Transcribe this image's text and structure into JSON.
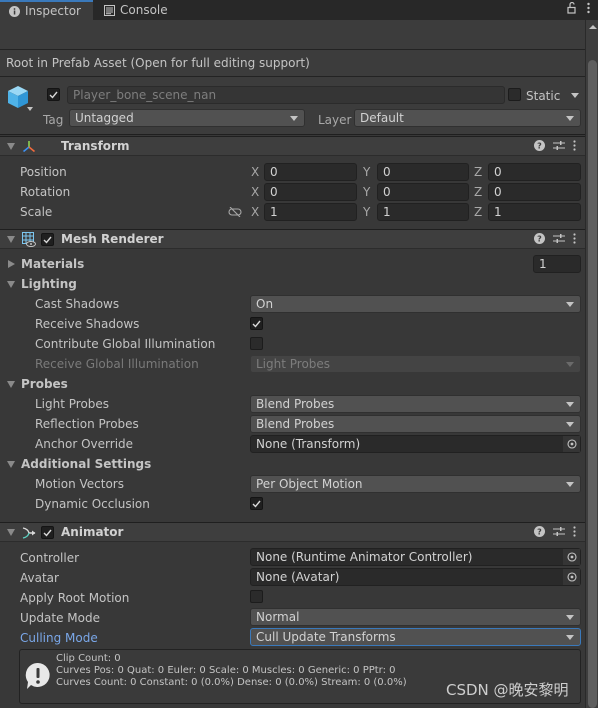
{
  "tabs": [
    {
      "label": "Inspector",
      "icon": "info-icon",
      "active": true
    },
    {
      "label": "Console",
      "icon": "console-icon",
      "active": false
    }
  ],
  "window_tools": {
    "lock": "lock-open-icon",
    "menu": "kebab-menu-icon"
  },
  "prefab_note": "Root in Prefab Asset (Open for full editing support)",
  "gameobject": {
    "active": true,
    "name": "Player_bone_scene_nan",
    "static_label": "Static",
    "static": false,
    "tag_label": "Tag",
    "tag": "Untagged",
    "layer_label": "Layer",
    "layer": "Default"
  },
  "transform": {
    "title": "Transform",
    "rows": [
      {
        "label": "Position",
        "x": "0",
        "y": "0",
        "z": "0"
      },
      {
        "label": "Rotation",
        "x": "0",
        "y": "0",
        "z": "0"
      },
      {
        "label": "Scale",
        "x": "1",
        "y": "1",
        "z": "1"
      }
    ],
    "axes": {
      "x": "X",
      "y": "Y",
      "z": "Z"
    }
  },
  "mesh_renderer": {
    "title": "Mesh Renderer",
    "enabled": true,
    "materials_label": "Materials",
    "materials_count": "1",
    "lighting_label": "Lighting",
    "cast_shadows_label": "Cast Shadows",
    "cast_shadows": "On",
    "receive_shadows_label": "Receive Shadows",
    "receive_shadows": true,
    "contribute_gi_label": "Contribute Global Illumination",
    "contribute_gi": false,
    "receive_gi_label": "Receive Global Illumination",
    "receive_gi": "Light Probes",
    "probes_label": "Probes",
    "light_probes_label": "Light Probes",
    "light_probes": "Blend Probes",
    "reflection_probes_label": "Reflection Probes",
    "reflection_probes": "Blend Probes",
    "anchor_override_label": "Anchor Override",
    "anchor_override": "None (Transform)",
    "additional_label": "Additional Settings",
    "motion_vectors_label": "Motion Vectors",
    "motion_vectors": "Per Object Motion",
    "dynamic_occlusion_label": "Dynamic Occlusion",
    "dynamic_occlusion": true
  },
  "animator": {
    "title": "Animator",
    "enabled": true,
    "controller_label": "Controller",
    "controller": "None (Runtime Animator Controller)",
    "avatar_label": "Avatar",
    "avatar": "None (Avatar)",
    "apply_root_motion_label": "Apply Root Motion",
    "apply_root_motion": false,
    "update_mode_label": "Update Mode",
    "update_mode": "Normal",
    "culling_mode_label": "Culling Mode",
    "culling_mode": "Cull Update Transforms",
    "info": [
      "Clip Count: 0",
      "Curves Pos: 0 Quat: 0 Euler: 0 Scale: 0 Muscles: 0 Generic: 0 PPtr: 0",
      "Curves Count: 0 Constant: 0 (0.0%) Dense: 0 (0.0%) Stream: 0 (0.0%)"
    ]
  },
  "watermark": "CSDN @晚安黎明",
  "colors": {
    "accent": "#3a79bb",
    "highlight_label": "#7aa7e8",
    "background": "#383838"
  }
}
